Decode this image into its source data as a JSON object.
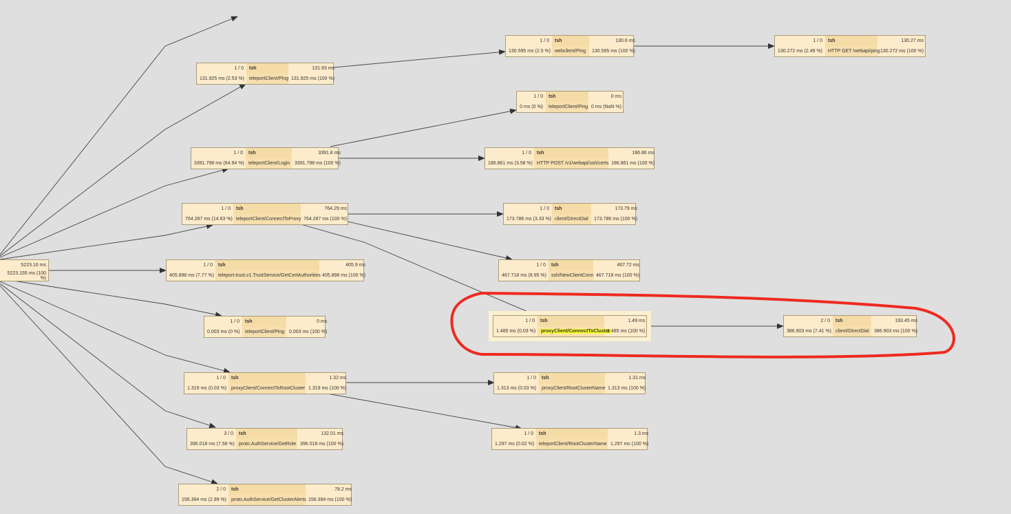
{
  "root": {
    "top_time": "5223.16 ms",
    "bottom_time": "5223.155 ms (100 %)"
  },
  "nodes": [
    {
      "count": "1 / 0",
      "name": "tsh",
      "total": "131.93 ms",
      "self": "131.925 ms (2.53 %)",
      "op": "teleportClient/Ping",
      "pct": "131.925 ms (100 %)"
    },
    {
      "count": "1 / 0",
      "name": "tsh",
      "total": "3391.8 ms",
      "self": "3391.798 ms (64.94 %)",
      "op": "teleportClient/Login",
      "pct": "3391.798 ms (100 %)"
    },
    {
      "count": "1 / 0",
      "name": "tsh",
      "total": "764.29 ms",
      "self": "764.287 ms (14.63 %)",
      "op": "teleportClient/ConnectToProxy",
      "pct": "764.287 ms (100 %)"
    },
    {
      "count": "1 / 0",
      "name": "tsh",
      "total": "405.9 ms",
      "self": "405.898 ms (7.77 %)",
      "op": "teleport.trust.v1.TrustService/GetCertAuthorities",
      "pct": "405.898 ms (100 %)"
    },
    {
      "count": "1 / 0",
      "name": "tsh",
      "total": "0 ms",
      "self": "0.003 ms (0 %)",
      "op": "teleportClient/Ping",
      "pct": "0.003 ms (100 %)"
    },
    {
      "count": "1 / 0",
      "name": "tsh",
      "total": "1.32 ms",
      "self": "1.319 ms (0.03 %)",
      "op": "proxyClient/ConnectToRootCluster",
      "pct": "1.319 ms (100 %)"
    },
    {
      "count": "3 / 0",
      "name": "tsh",
      "total": "132.01 ms",
      "self": "396.018 ms (7.58 %)",
      "op": "proto.AuthService/GetRole",
      "pct": "396.018 ms (100 %)"
    },
    {
      "count": "2 / 0",
      "name": "tsh",
      "total": "78.2 ms",
      "self": "156.394 ms (2.99 %)",
      "op": "proto.AuthService/GetClusterAlerts",
      "pct": "156.394 ms (100 %)"
    },
    {
      "count": "1 / 0",
      "name": "tsh",
      "total": "130.6 ms",
      "self": "130.595 ms (2.5 %)",
      "op": "webclient/Ping",
      "pct": "130.595 ms (100 %)"
    },
    {
      "count": "1 / 0",
      "name": "tsh",
      "total": "0 ms",
      "self": "0 ms (0 %)",
      "op": "teleportClient/Ping",
      "pct": "0 ms (NaN %)"
    },
    {
      "count": "1 / 0",
      "name": "tsh",
      "total": "186.86 ms",
      "self": "186.861 ms (3.58 %)",
      "op": "HTTP POST /v1/webapi/ssh/certs",
      "pct": "186.861 ms (100 %)"
    },
    {
      "count": "1 / 0",
      "name": "tsh",
      "total": "173.79 ms",
      "self": "173.786 ms (3.33 %)",
      "op": "client/DirectDial",
      "pct": "173.786 ms (100 %)"
    },
    {
      "count": "1 / 0",
      "name": "tsh",
      "total": "467.72 ms",
      "self": "467.718 ms (8.95 %)",
      "op": "ssh/NewClientConn",
      "pct": "467.718 ms (100 %)"
    },
    {
      "count": "1 / 0",
      "name": "tsh",
      "total": "1.49 ms",
      "self": "1.485 ms (0.03 %)",
      "op": "proxyClient/ConnectToCluster",
      "pct": "1.485 ms (100 %)"
    },
    {
      "count": "1 / 0",
      "name": "tsh",
      "total": "1.31 ms",
      "self": "1.313 ms (0.03 %)",
      "op": "proxyClient/RootClusterName",
      "pct": "1.313 ms (100 %)"
    },
    {
      "count": "1 / 0",
      "name": "tsh",
      "total": "1.3 ms",
      "self": "1.297 ms (0.02 %)",
      "op": "teleportClient/RootClusterName",
      "pct": "1.297 ms (100 %)"
    },
    {
      "count": "1 / 0",
      "name": "tsh",
      "total": "130.27 ms",
      "self": "130.272 ms (2.49 %)",
      "op": "HTTP GET /webapi/ping",
      "pct": "130.272 ms (100 %)"
    },
    {
      "count": "2 / 0",
      "name": "tsh",
      "total": "193.45 ms",
      "self": "386.903 ms (7.41 %)",
      "op": "client/DirectDial",
      "pct": "386.903 ms (100 %)"
    }
  ],
  "colors": {
    "background": "#dfdfdf",
    "node_fill": "#fdeccb",
    "node_border": "#a89a7a",
    "highlight": "#ffff30",
    "annotation_circle": "#ee2a20"
  }
}
